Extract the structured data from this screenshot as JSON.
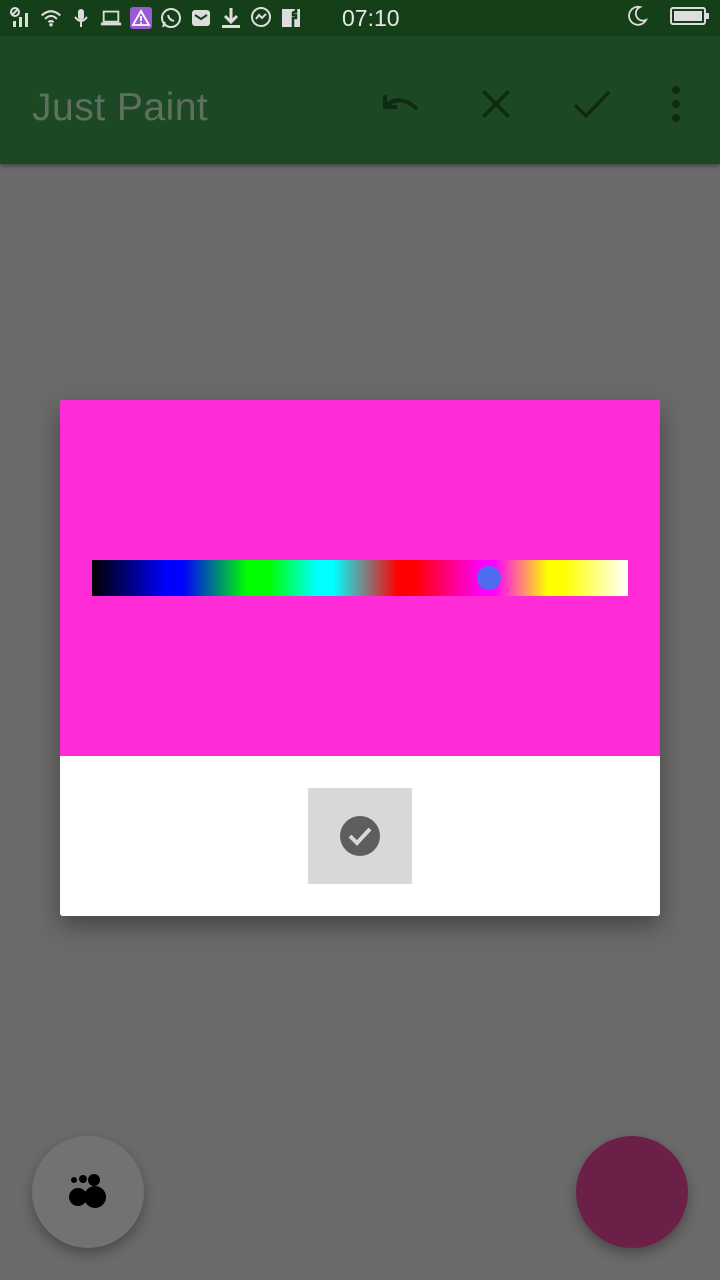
{
  "status_bar": {
    "time": "07:10",
    "icons": [
      "signal-icon",
      "wifi-icon",
      "mic-icon",
      "laptop-icon",
      "warning-icon",
      "whatsapp-icon",
      "mail-icon",
      "download-icon",
      "messenger-icon",
      "facebook-icon",
      "moon-icon",
      "battery-icon"
    ],
    "background": "#153f19"
  },
  "app_bar": {
    "title": "Just Paint",
    "actions": [
      "undo-icon",
      "close-icon",
      "check-icon",
      "more-vert-icon"
    ],
    "background": "#1c4923"
  },
  "color_picker": {
    "selected_color": "#ff2bd7",
    "spectrum_position": 0.74,
    "knob_color": "#4f6cf0",
    "confirm_icon": "check-circle-icon"
  },
  "fabs": {
    "left_icon": "brush-dots-icon",
    "right_color": "#6c2047"
  }
}
